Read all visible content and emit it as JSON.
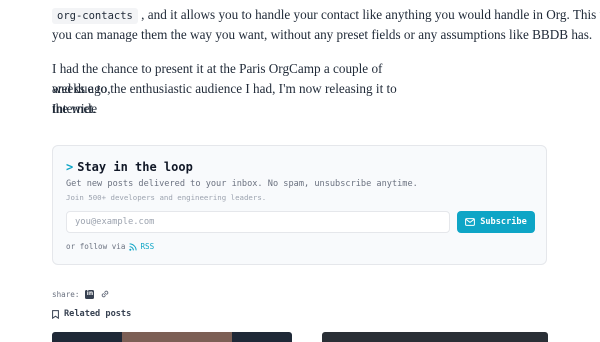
{
  "article": {
    "p1_code": "org-contacts",
    "p1_line1_rest": ", and it allows you to handle your contact like anything you would handle in Org. This way",
    "p1_line2": "you can manage them the way you want, without any preset fields or any assumptions like BBDB has.",
    "p2_lines": [
      "I had the chance to present it at the Paris OrgCamp a couple of weeks ago,",
      "and due to the enthusiastic audience I had, I'm now releasing it to the wide",
      "Internet."
    ]
  },
  "newsletter": {
    "prompt": ">",
    "title": "Stay in the loop",
    "subtitle": "Get new posts delivered to your inbox. No spam, unsubscribe anytime.",
    "social_proof": "Join 500+ developers and engineering leaders.",
    "email_placeholder": "you@example.com",
    "subscribe_label": "Subscribe",
    "follow_text": "or follow via",
    "rss_label": "RSS"
  },
  "share": {
    "label": "share:",
    "linkedin_letters": "in"
  },
  "related": {
    "label": "Related posts"
  },
  "colors": {
    "accent": "#0ea5c6",
    "card_bg": "#f8fafc",
    "text": "#1f2937",
    "muted": "#6b7280"
  },
  "icons": [
    "mail-icon",
    "rss-icon",
    "linkedin-icon",
    "link-icon",
    "bookmark-icon"
  ]
}
